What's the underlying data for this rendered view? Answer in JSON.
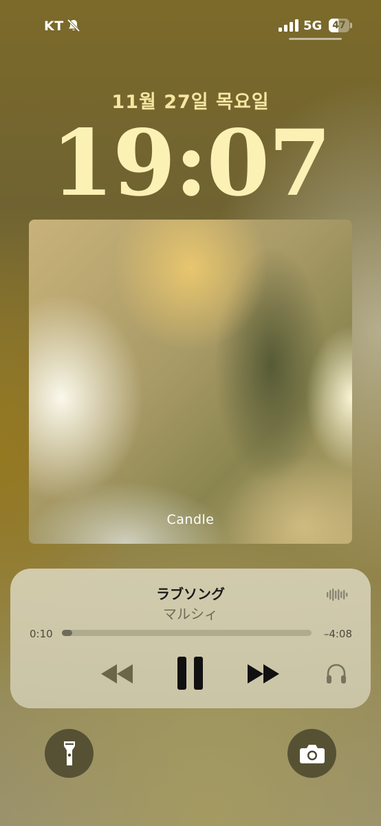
{
  "status_bar": {
    "carrier": "KT",
    "network": "5G",
    "battery": "47",
    "silent_icon": "bell-slash-icon",
    "signal_icon": "cellular-signal-icon"
  },
  "lock_screen": {
    "date": "11월 27일 목요일",
    "time": "19:07"
  },
  "now_playing": {
    "artwork_caption": "Candle",
    "title": "ラブソング",
    "artist": "マルシィ",
    "elapsed": "0:10",
    "remaining": "–4:08",
    "progress_fraction": 0.04,
    "controls": [
      "rewind-icon",
      "pause-icon",
      "fast-forward-icon",
      "headphones-icon",
      "audio-waveform-icon"
    ]
  },
  "quick_actions": {
    "left_icon": "flashlight-icon",
    "right_icon": "camera-icon"
  },
  "colors": {
    "clock": "#fbf1b5",
    "player_card": "#d6d0b4",
    "accent_dark": "#1a1a1a"
  }
}
